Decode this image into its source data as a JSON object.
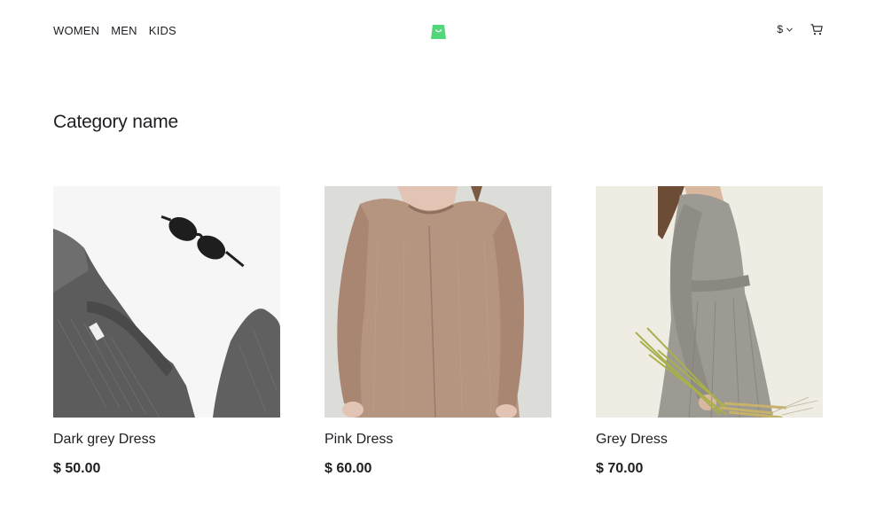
{
  "header": {
    "nav": [
      {
        "label": "WOMEN"
      },
      {
        "label": "MEN"
      },
      {
        "label": "KIDS"
      }
    ],
    "logo_icon": "shopping-bag-logo-icon",
    "brand_color": "#52d67a",
    "currency": {
      "symbol": "$",
      "chevron_icon": "chevron-down-icon"
    },
    "cart_icon": "cart-icon"
  },
  "main": {
    "category_title": "Category name",
    "products": [
      {
        "name": "Dark grey Dress",
        "price": "$ 50.00",
        "image": "grey-knit-sweater-photo"
      },
      {
        "name": "Pink Dress",
        "price": "$ 60.00",
        "image": "beige-knit-dress-photo"
      },
      {
        "name": "Grey Dress",
        "price": "$ 70.00",
        "image": "grey-linen-dress-photo"
      }
    ]
  }
}
